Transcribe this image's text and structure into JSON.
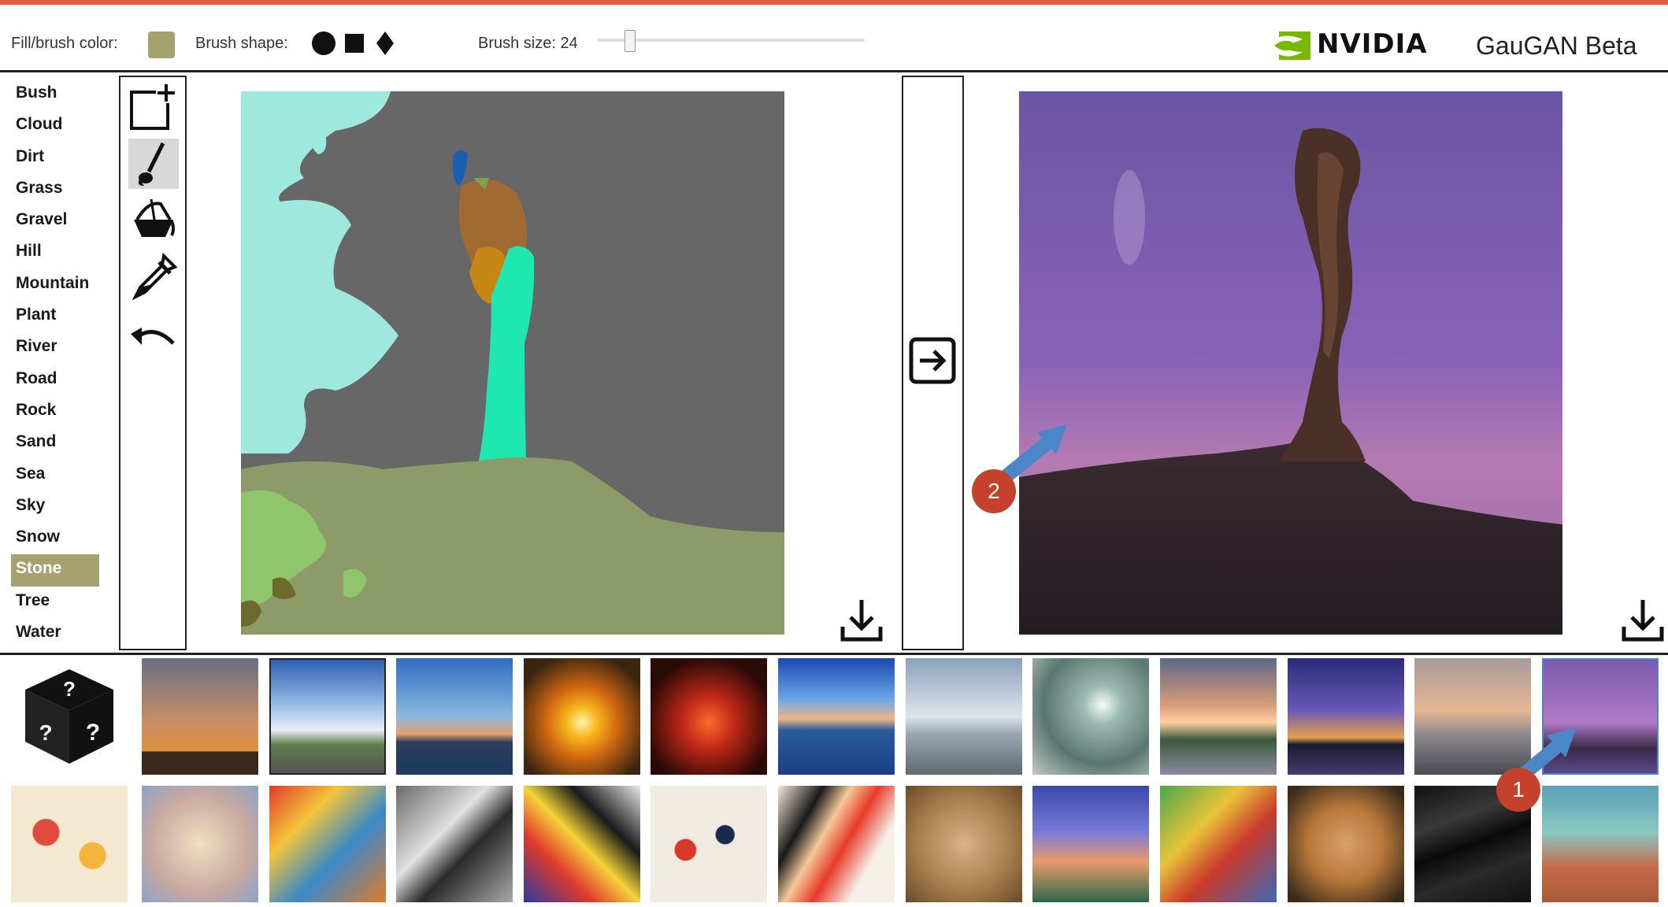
{
  "app": {
    "title": "GauGAN Beta",
    "brand": "NVIDIA"
  },
  "toolbar": {
    "fill_label": "Fill/brush color:",
    "fill_color": "#a4a36f",
    "shape_label": "Brush shape:",
    "shapes": [
      "circle",
      "square",
      "diamond"
    ],
    "size_label": "Brush size: 24",
    "size_value": 24
  },
  "labels": [
    "Bush",
    "Cloud",
    "Dirt",
    "Grass",
    "Gravel",
    "Hill",
    "Mountain",
    "Plant",
    "River",
    "Road",
    "Rock",
    "Sand",
    "Sea",
    "Sky",
    "Snow",
    "Stone",
    "Tree",
    "Water"
  ],
  "selected_label": "Stone",
  "tools": [
    "new-canvas-icon",
    "brush-icon",
    "fill-bucket-icon",
    "eyedropper-icon",
    "undo-icon"
  ],
  "active_tool": "brush-icon",
  "annotations": {
    "badge1": "1",
    "badge2": "2"
  },
  "colors": {
    "accent": "#c6412b",
    "arrow": "#4a86c8",
    "nvidia_green": "#76b900"
  }
}
